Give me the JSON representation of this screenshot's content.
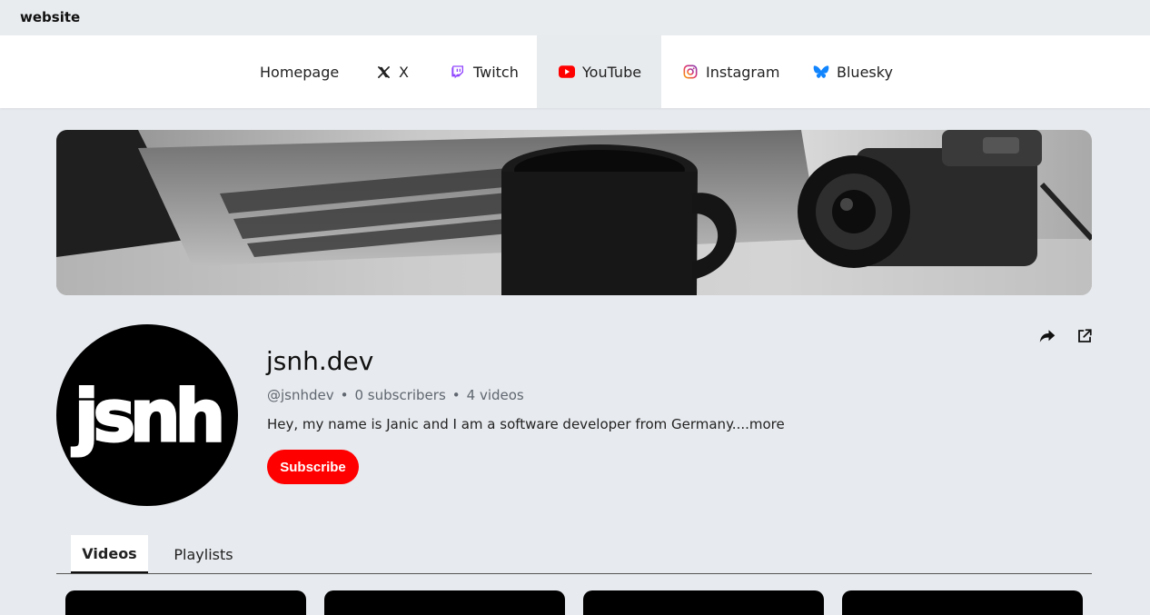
{
  "topbar": {
    "brand": "website"
  },
  "nav": {
    "items": [
      {
        "label": "Homepage",
        "icon": ""
      },
      {
        "label": "X",
        "icon": "x-logo-icon"
      },
      {
        "label": "Twitch",
        "icon": "twitch-icon"
      },
      {
        "label": "YouTube",
        "icon": "youtube-icon",
        "active": true
      },
      {
        "label": "Instagram",
        "icon": "instagram-icon"
      },
      {
        "label": "Bluesky",
        "icon": "bluesky-icon"
      }
    ]
  },
  "channel": {
    "avatar_text": "jsnh",
    "name": "jsnh.dev",
    "handle": "@jsnhdev",
    "subscribers": "0 subscribers",
    "videos": "4 videos",
    "description": "Hey, my name is Janic and I am a software developer from Germany.",
    "more": "...more",
    "subscribe_label": "Subscribe"
  },
  "tabs": [
    {
      "label": "Videos",
      "active": true
    },
    {
      "label": "Playlists"
    }
  ],
  "colors": {
    "accent": "#ff0000",
    "background": "#e7eaee",
    "nav_bg": "#ffffff"
  }
}
